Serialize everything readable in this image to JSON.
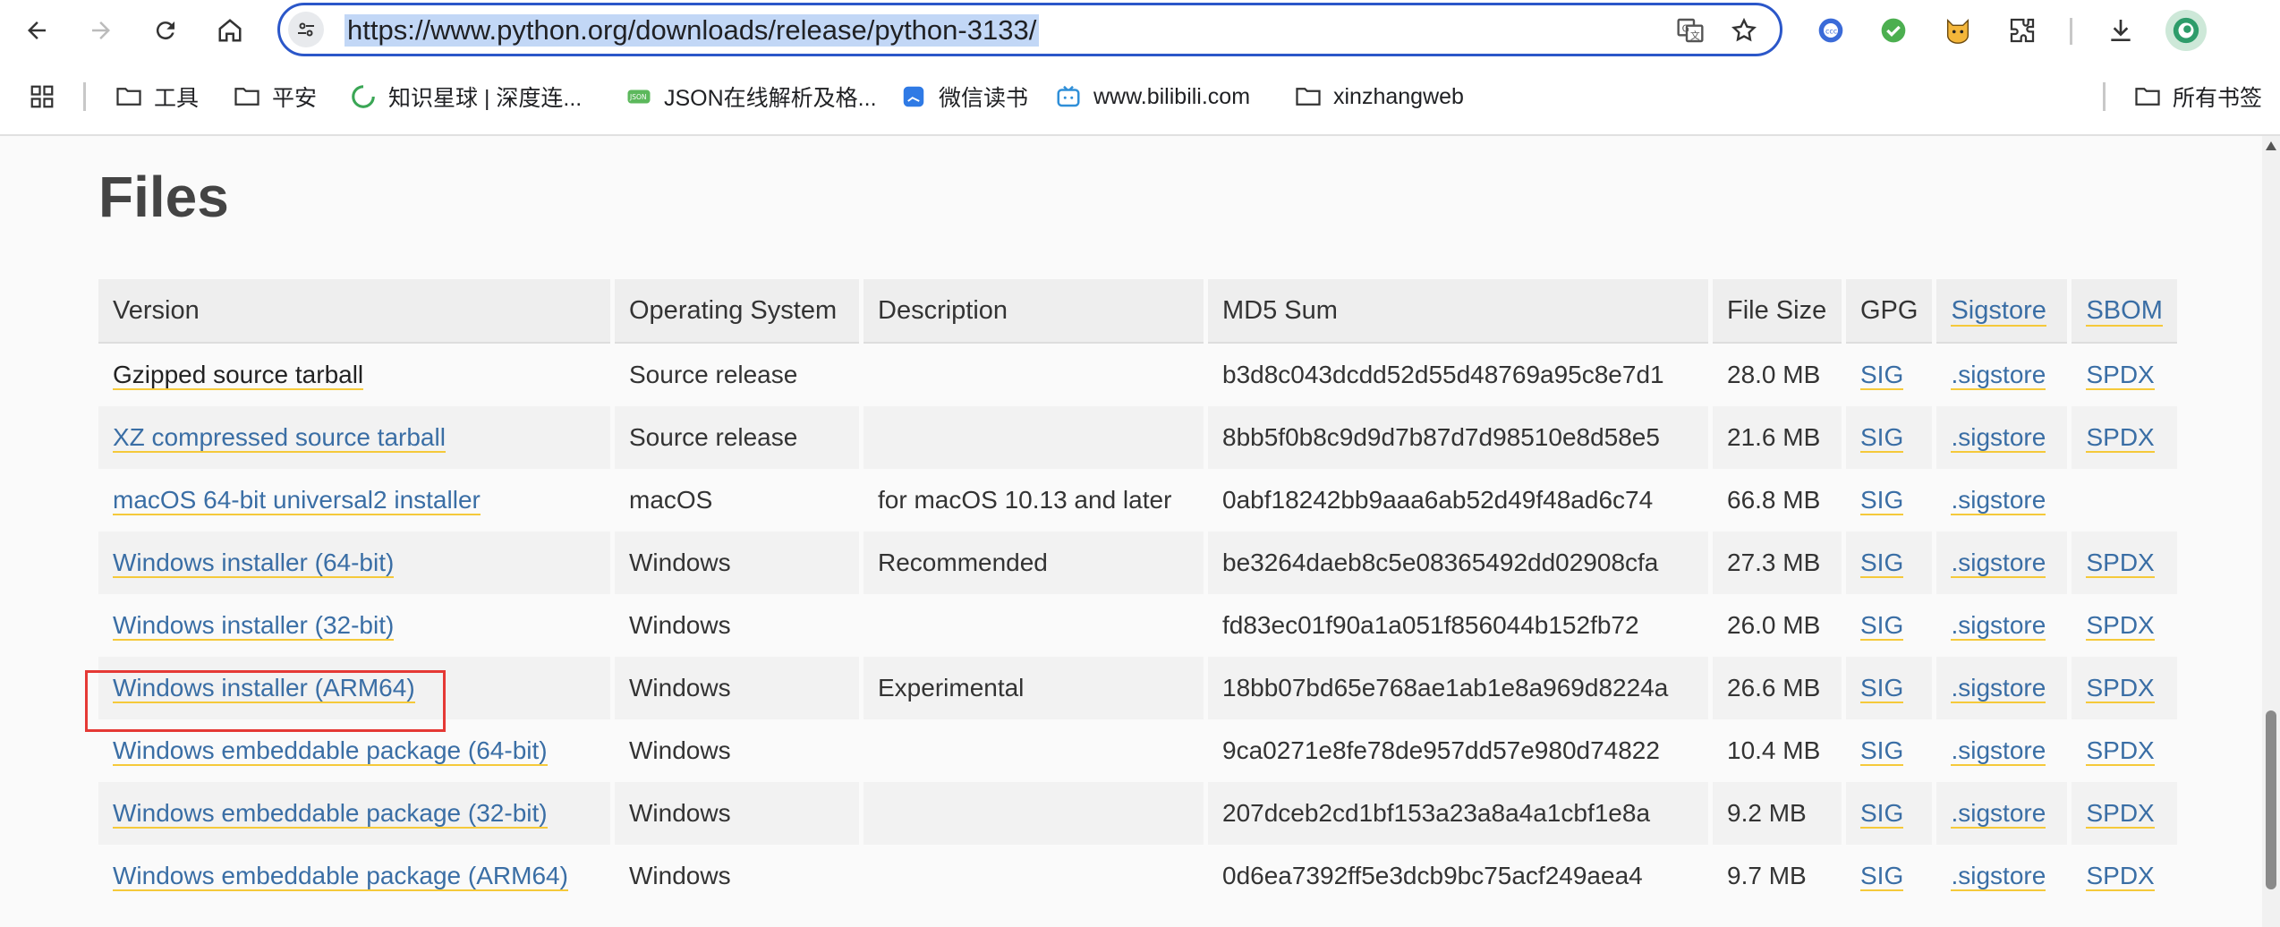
{
  "browser": {
    "url": "https://www.python.org/downloads/release/python-3133/",
    "bookmarks": [
      {
        "label": "工具",
        "icon": "folder-icon"
      },
      {
        "label": "平安",
        "icon": "folder-icon"
      },
      {
        "label": "知识星球 | 深度连...",
        "icon": "zsxq-icon"
      },
      {
        "label": "JSON在线解析及格...",
        "icon": "json-icon"
      },
      {
        "label": "微信读书",
        "icon": "weread-icon"
      },
      {
        "label": "www.bilibili.com",
        "icon": "bilibili-icon"
      },
      {
        "label": "xinzhangweb",
        "icon": "folder-icon"
      }
    ],
    "all_bookmarks": "所有书签"
  },
  "page": {
    "title": "Files",
    "table": {
      "headers": [
        "Version",
        "Operating System",
        "Description",
        "MD5 Sum",
        "File Size",
        "GPG",
        "Sigstore",
        "SBOM"
      ],
      "rows": [
        {
          "version": "Gzipped source tarball",
          "os": "Source release",
          "desc": "",
          "md5": "b3d8c043dcdd52d55d48769a95c8e7d1",
          "size": "28.0 MB",
          "gpg": "SIG",
          "sigstore": ".sigstore",
          "sbom": "SPDX"
        },
        {
          "version": "XZ compressed source tarball",
          "os": "Source release",
          "desc": "",
          "md5": "8bb5f0b8c9d9d7b87d7d98510e8d58e5",
          "size": "21.6 MB",
          "gpg": "SIG",
          "sigstore": ".sigstore",
          "sbom": "SPDX"
        },
        {
          "version": "macOS 64-bit universal2 installer",
          "os": "macOS",
          "desc": "for macOS 10.13 and later",
          "md5": "0abf18242bb9aaa6ab52d49f48ad6c74",
          "size": "66.8 MB",
          "gpg": "SIG",
          "sigstore": ".sigstore",
          "sbom": ""
        },
        {
          "version": "Windows installer (64-bit)",
          "os": "Windows",
          "desc": "Recommended",
          "md5": "be3264daeb8c5e08365492dd02908cfa",
          "size": "27.3 MB",
          "gpg": "SIG",
          "sigstore": ".sigstore",
          "sbom": "SPDX"
        },
        {
          "version": "Windows installer (32-bit)",
          "os": "Windows",
          "desc": "",
          "md5": "fd83ec01f90a1a051f856044b152fb72",
          "size": "26.0 MB",
          "gpg": "SIG",
          "sigstore": ".sigstore",
          "sbom": "SPDX"
        },
        {
          "version": "Windows installer (ARM64)",
          "os": "Windows",
          "desc": "Experimental",
          "md5": "18bb07bd65e768ae1ab1e8a969d8224a",
          "size": "26.6 MB",
          "gpg": "SIG",
          "sigstore": ".sigstore",
          "sbom": "SPDX"
        },
        {
          "version": "Windows embeddable package (64-bit)",
          "os": "Windows",
          "desc": "",
          "md5": "9ca0271e8fe78de957dd57e980d74822",
          "size": "10.4 MB",
          "gpg": "SIG",
          "sigstore": ".sigstore",
          "sbom": "SPDX"
        },
        {
          "version": "Windows embeddable package (32-bit)",
          "os": "Windows",
          "desc": "",
          "md5": "207dceb2cd1bf153a23a8a4a1cbf1e8a",
          "size": "9.2 MB",
          "gpg": "SIG",
          "sigstore": ".sigstore",
          "sbom": "SPDX"
        },
        {
          "version": "Windows embeddable package (ARM64)",
          "os": "Windows",
          "desc": "",
          "md5": "0d6ea7392ff5e3dcb9bc75acf249aea4",
          "size": "9.7 MB",
          "gpg": "SIG",
          "sigstore": ".sigstore",
          "sbom": "SPDX"
        }
      ]
    }
  },
  "colors": {
    "link": "#3a6ea5",
    "link_underline": "#f5c93a",
    "highlight": "#e53935",
    "omnibox_border": "#2b57c9"
  }
}
